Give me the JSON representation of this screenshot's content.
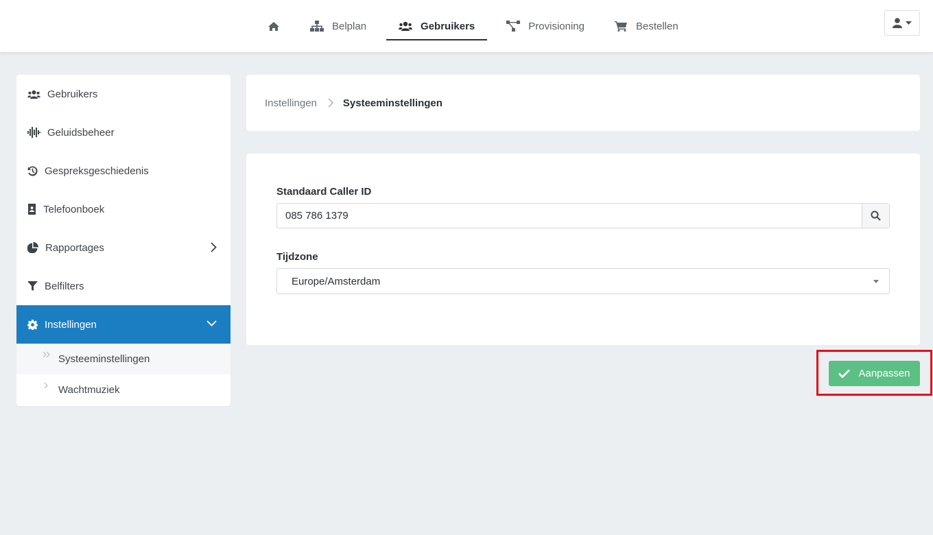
{
  "nav": {
    "home_icon": "home-icon",
    "items": [
      {
        "label": "Belplan",
        "icon": "sitemap-icon"
      },
      {
        "label": "Gebruikers",
        "icon": "users-icon",
        "active": true
      },
      {
        "label": "Provisioning",
        "icon": "network-icon"
      },
      {
        "label": "Bestellen",
        "icon": "cart-icon"
      }
    ],
    "user_menu_icon": "user-icon"
  },
  "sidebar": {
    "items": [
      {
        "label": "Gebruikers",
        "icon": "users-icon"
      },
      {
        "label": "Geluidsbeheer",
        "icon": "waveform-icon"
      },
      {
        "label": "Gespreksgeschiedenis",
        "icon": "history-icon"
      },
      {
        "label": "Telefoonboek",
        "icon": "address-book-icon"
      },
      {
        "label": "Rapportages",
        "icon": "pie-chart-icon",
        "expandable": true
      },
      {
        "label": "Belfilters",
        "icon": "filter-icon"
      },
      {
        "label": "Instellingen",
        "icon": "gear-icon",
        "active": true,
        "expanded": true
      }
    ],
    "subitems": [
      {
        "label": "Systeeminstellingen",
        "current": true
      },
      {
        "label": "Wachtmuziek"
      }
    ]
  },
  "breadcrumb": {
    "parent": "Instellingen",
    "current": "Systeeminstellingen"
  },
  "form": {
    "caller_id_label": "Standaard Caller ID",
    "caller_id_value": "085 786 1379",
    "timezone_label": "Tijdzone",
    "timezone_value": "Europe/Amsterdam"
  },
  "actions": {
    "submit_label": "Aanpassen"
  },
  "colors": {
    "primary": "#1b7ec2",
    "success": "#5cbf83",
    "highlight": "#e2101e",
    "background": "#eceff2"
  }
}
